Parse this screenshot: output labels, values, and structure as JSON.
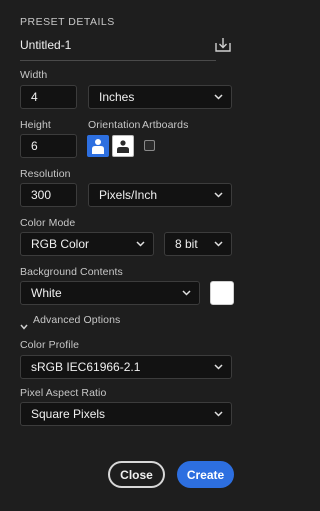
{
  "header": {
    "title": "PRESET DETAILS"
  },
  "preset": {
    "name": "Untitled-1",
    "save_icon": "save-preset-icon"
  },
  "width": {
    "label": "Width",
    "value": "4",
    "unit": "Inches"
  },
  "height": {
    "label": "Height",
    "value": "6"
  },
  "orientation": {
    "label": "Orientation",
    "selected": "portrait"
  },
  "artboards": {
    "label": "Artboards",
    "checked": false
  },
  "resolution": {
    "label": "Resolution",
    "value": "300",
    "unit": "Pixels/Inch"
  },
  "color_mode": {
    "label": "Color Mode",
    "mode": "RGB Color",
    "depth": "8 bit"
  },
  "background": {
    "label": "Background Contents",
    "value": "White",
    "swatch_color": "#ffffff"
  },
  "advanced": {
    "label": "Advanced Options"
  },
  "color_profile": {
    "label": "Color Profile",
    "value": "sRGB IEC61966-2.1"
  },
  "pixel_aspect": {
    "label": "Pixel Aspect Ratio",
    "value": "Square Pixels"
  },
  "buttons": {
    "close": "Close",
    "create": "Create"
  },
  "colors": {
    "accent": "#2d6fe0",
    "background": "#1e1e1e",
    "field": "#121212"
  }
}
